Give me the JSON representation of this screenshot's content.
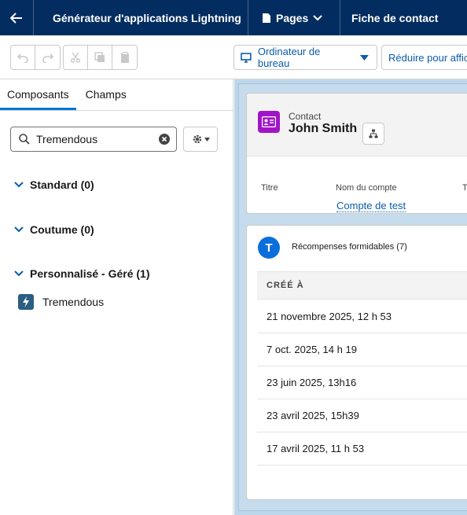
{
  "topbar": {
    "app_title": "Générateur d'applications Lightning",
    "pages_label": "Pages",
    "page_name": "Fiche de contact"
  },
  "toolbar": {
    "device_label": "Ordinateur de bureau",
    "reduce_label": "Réduire pour affic"
  },
  "left_panel": {
    "tabs": [
      "Composants",
      "Champs"
    ],
    "search_value": "Tremendous",
    "sections": [
      {
        "label": "Standard (0)"
      },
      {
        "label": "Coutume (0)"
      },
      {
        "label": "Personnalisé - Géré (1)"
      }
    ],
    "component_label": "Tremendous"
  },
  "record": {
    "object_label": "Contact",
    "name": "John Smith",
    "fields": {
      "title_label": "Titre",
      "account_label": "Nom du compte",
      "phone_label": "Té",
      "account_value": "Compte de test"
    }
  },
  "rewards": {
    "badge": "T",
    "title": "Récompenses formidables (7)",
    "column_header": "CRÉÉ À",
    "rows": [
      "21 novembre 2025, 12 h 53",
      "7 oct. 2025, 14 h 19",
      "23 juin 2025, 13h16",
      "23 avril 2025, 15h39",
      "17 avril 2025, 11 h 53"
    ]
  },
  "colors": {
    "topbar_bg": "#032d60",
    "accent": "#0176d3",
    "link": "#0b5cab",
    "contact_icon": "#a215c7",
    "canvas_bg": "#bcd6ea"
  }
}
